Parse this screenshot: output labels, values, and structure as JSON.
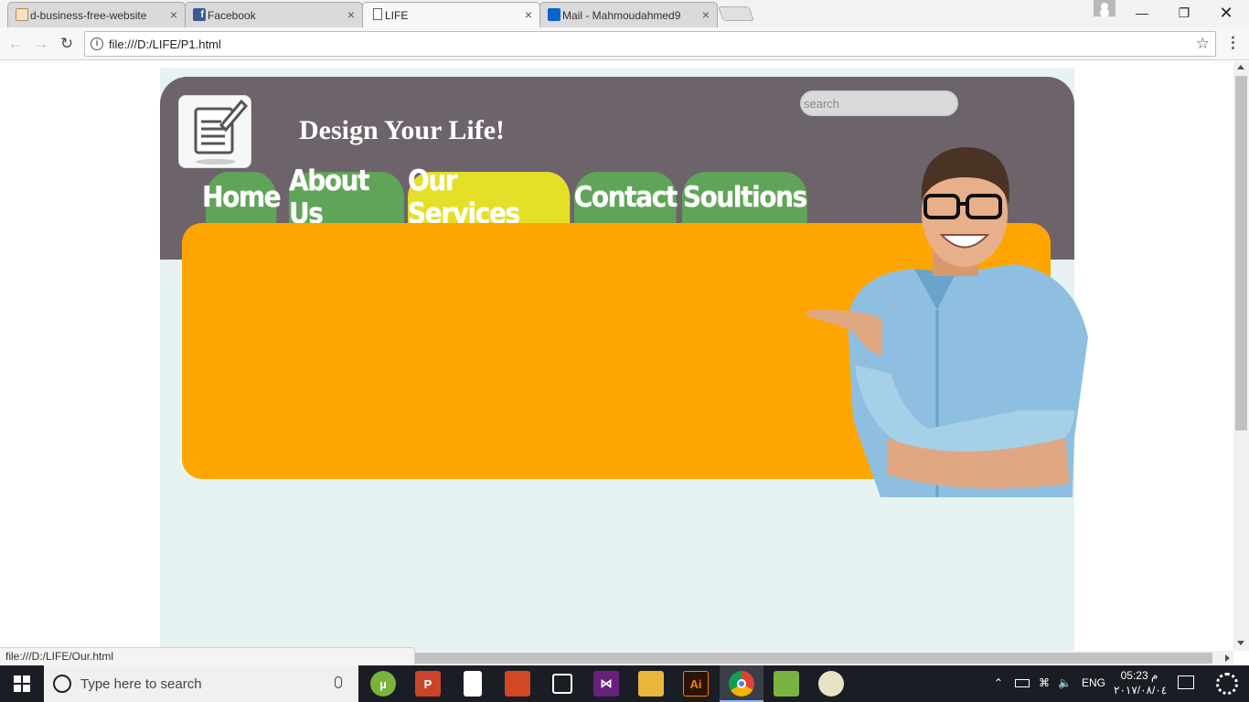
{
  "browser": {
    "tabs": [
      {
        "title": "d-business-free-website",
        "active": false
      },
      {
        "title": "Facebook",
        "active": false
      },
      {
        "title": "LIFE",
        "active": true
      },
      {
        "title": "Mail - Mahmoudahmed9",
        "active": false
      }
    ],
    "close_glyph": "×",
    "url": "file:///D:/LIFE/P1.html",
    "status_url": "file:///D:/LIFE/Our.html"
  },
  "site": {
    "title": "Design Your Life!",
    "search_placeholder": "search",
    "nav": [
      {
        "label": "Home",
        "highlighted": false
      },
      {
        "label": "About Us",
        "highlighted": false
      },
      {
        "label": "Our Services",
        "highlighted": true
      },
      {
        "label": "Contact",
        "highlighted": false
      },
      {
        "label": "Soultions",
        "highlighted": false
      }
    ],
    "colors": {
      "header": "#6d636b",
      "nav_tab": "#5fa458",
      "nav_tab_active": "#e4df28",
      "content_box": "#ffa500",
      "page_bg": "#e7f3f3"
    }
  },
  "taskbar": {
    "search_placeholder": "Type here to search",
    "language": "ENG",
    "time": "05:23 م",
    "date": "٢٠١٧/٠٨/٠٤"
  }
}
